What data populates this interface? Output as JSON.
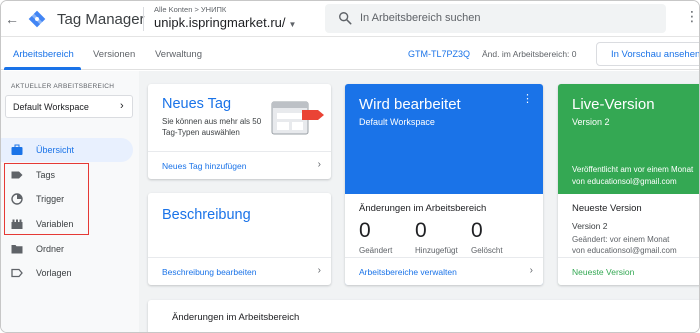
{
  "colors": {
    "primary": "#1a73e8",
    "live": "#34a853",
    "highlight": "#e53935"
  },
  "topbar": {
    "back_icon": "back-arrow-icon",
    "app_title": "Tag Manager",
    "breadcrumb": "Alle Konten > УНИПК",
    "container_name": "unipk.ispringmarket.ru/",
    "search_placeholder": "In Arbeitsbereich suchen",
    "more_icon": "more-vert-icon"
  },
  "tabs": {
    "items": [
      {
        "label": "Arbeitsbereich"
      },
      {
        "label": "Versionen"
      },
      {
        "label": "Verwaltung"
      }
    ],
    "active": "Arbeitsbereich",
    "container_id": "GTM-TL7PZ3Q",
    "workspace_changes": "Änd. im Arbeitsbereich: 0",
    "preview_button": "In Vorschau ansehen"
  },
  "sidebar": {
    "workspace_label": "AKTUELLER ARBEITSBEREICH",
    "workspace_name": "Default Workspace",
    "items": [
      {
        "label": "Übersicht",
        "icon": "briefcase-icon"
      },
      {
        "label": "Tags",
        "icon": "tag-icon"
      },
      {
        "label": "Trigger",
        "icon": "trigger-icon"
      },
      {
        "label": "Variablen",
        "icon": "variables-icon"
      },
      {
        "label": "Ordner",
        "icon": "folder-icon"
      },
      {
        "label": "Vorlagen",
        "icon": "template-icon"
      }
    ]
  },
  "cards": {
    "new_tag": {
      "title": "Neues Tag",
      "description": "Sie können aus mehr als 50 Tag-Typen auswählen",
      "link": "Neues Tag hinzufügen"
    },
    "description": {
      "title": "Beschreibung",
      "link": "Beschreibung bearbeiten"
    },
    "editing": {
      "title": "Wird bearbeitet",
      "workspace": "Default Workspace",
      "changes_title": "Änderungen im Arbeitsbereich",
      "stats": [
        {
          "value": "0",
          "label": "Geändert"
        },
        {
          "value": "0",
          "label": "Hinzugefügt"
        },
        {
          "value": "0",
          "label": "Gelöscht"
        }
      ],
      "link": "Arbeitsbereiche verwalten"
    },
    "live": {
      "title": "Live-Version",
      "version": "Version 2",
      "published_line1": "Veröffentlicht am vor einem Monat",
      "published_line2": "von educationsol@gmail.com",
      "newest_title": "Neueste Version",
      "newest_version": "Version 2",
      "newest_changed_line1": "Geändert: vor einem Monat",
      "newest_changed_line2": "von educationsol@gmail.com",
      "link": "Neueste Version"
    },
    "workspace_changes": {
      "title": "Änderungen im Arbeitsbereich"
    }
  }
}
